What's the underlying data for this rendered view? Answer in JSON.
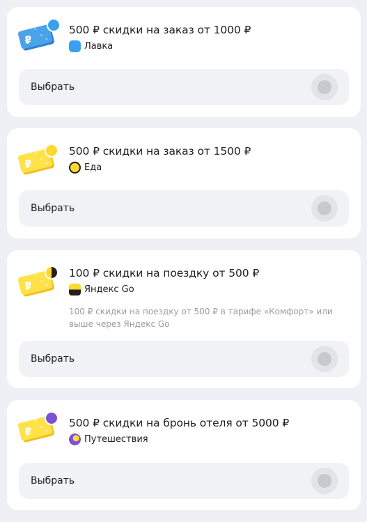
{
  "offers": [
    {
      "title": "500 ₽ скидки на заказ от 1000 ₽",
      "service": "Лавка",
      "service_icon": "lavka-icon",
      "coupon_color": "#4aa3e8",
      "select_label": "Выбрать"
    },
    {
      "title": "500 ₽ скидки на заказ от 1500 ₽",
      "service": "Еда",
      "service_icon": "eda-icon",
      "coupon_color": "#ffd932",
      "select_label": "Выбрать"
    },
    {
      "title": "100 ₽ скидки на поездку от 500 ₽",
      "service": "Яндекс Go",
      "service_icon": "yandex-go-icon",
      "coupon_color": "#ffd932",
      "description": "100 ₽ скидки на поездку от 500 ₽ в тарифе «Комфорт» или выше через Яндекс Go",
      "select_label": "Выбрать"
    },
    {
      "title": "500 ₽ скидки на бронь отеля от 5000 ₽",
      "service": "Путешествия",
      "service_icon": "travel-icon",
      "coupon_color": "#ffd932",
      "select_label": "Выбрать"
    }
  ]
}
